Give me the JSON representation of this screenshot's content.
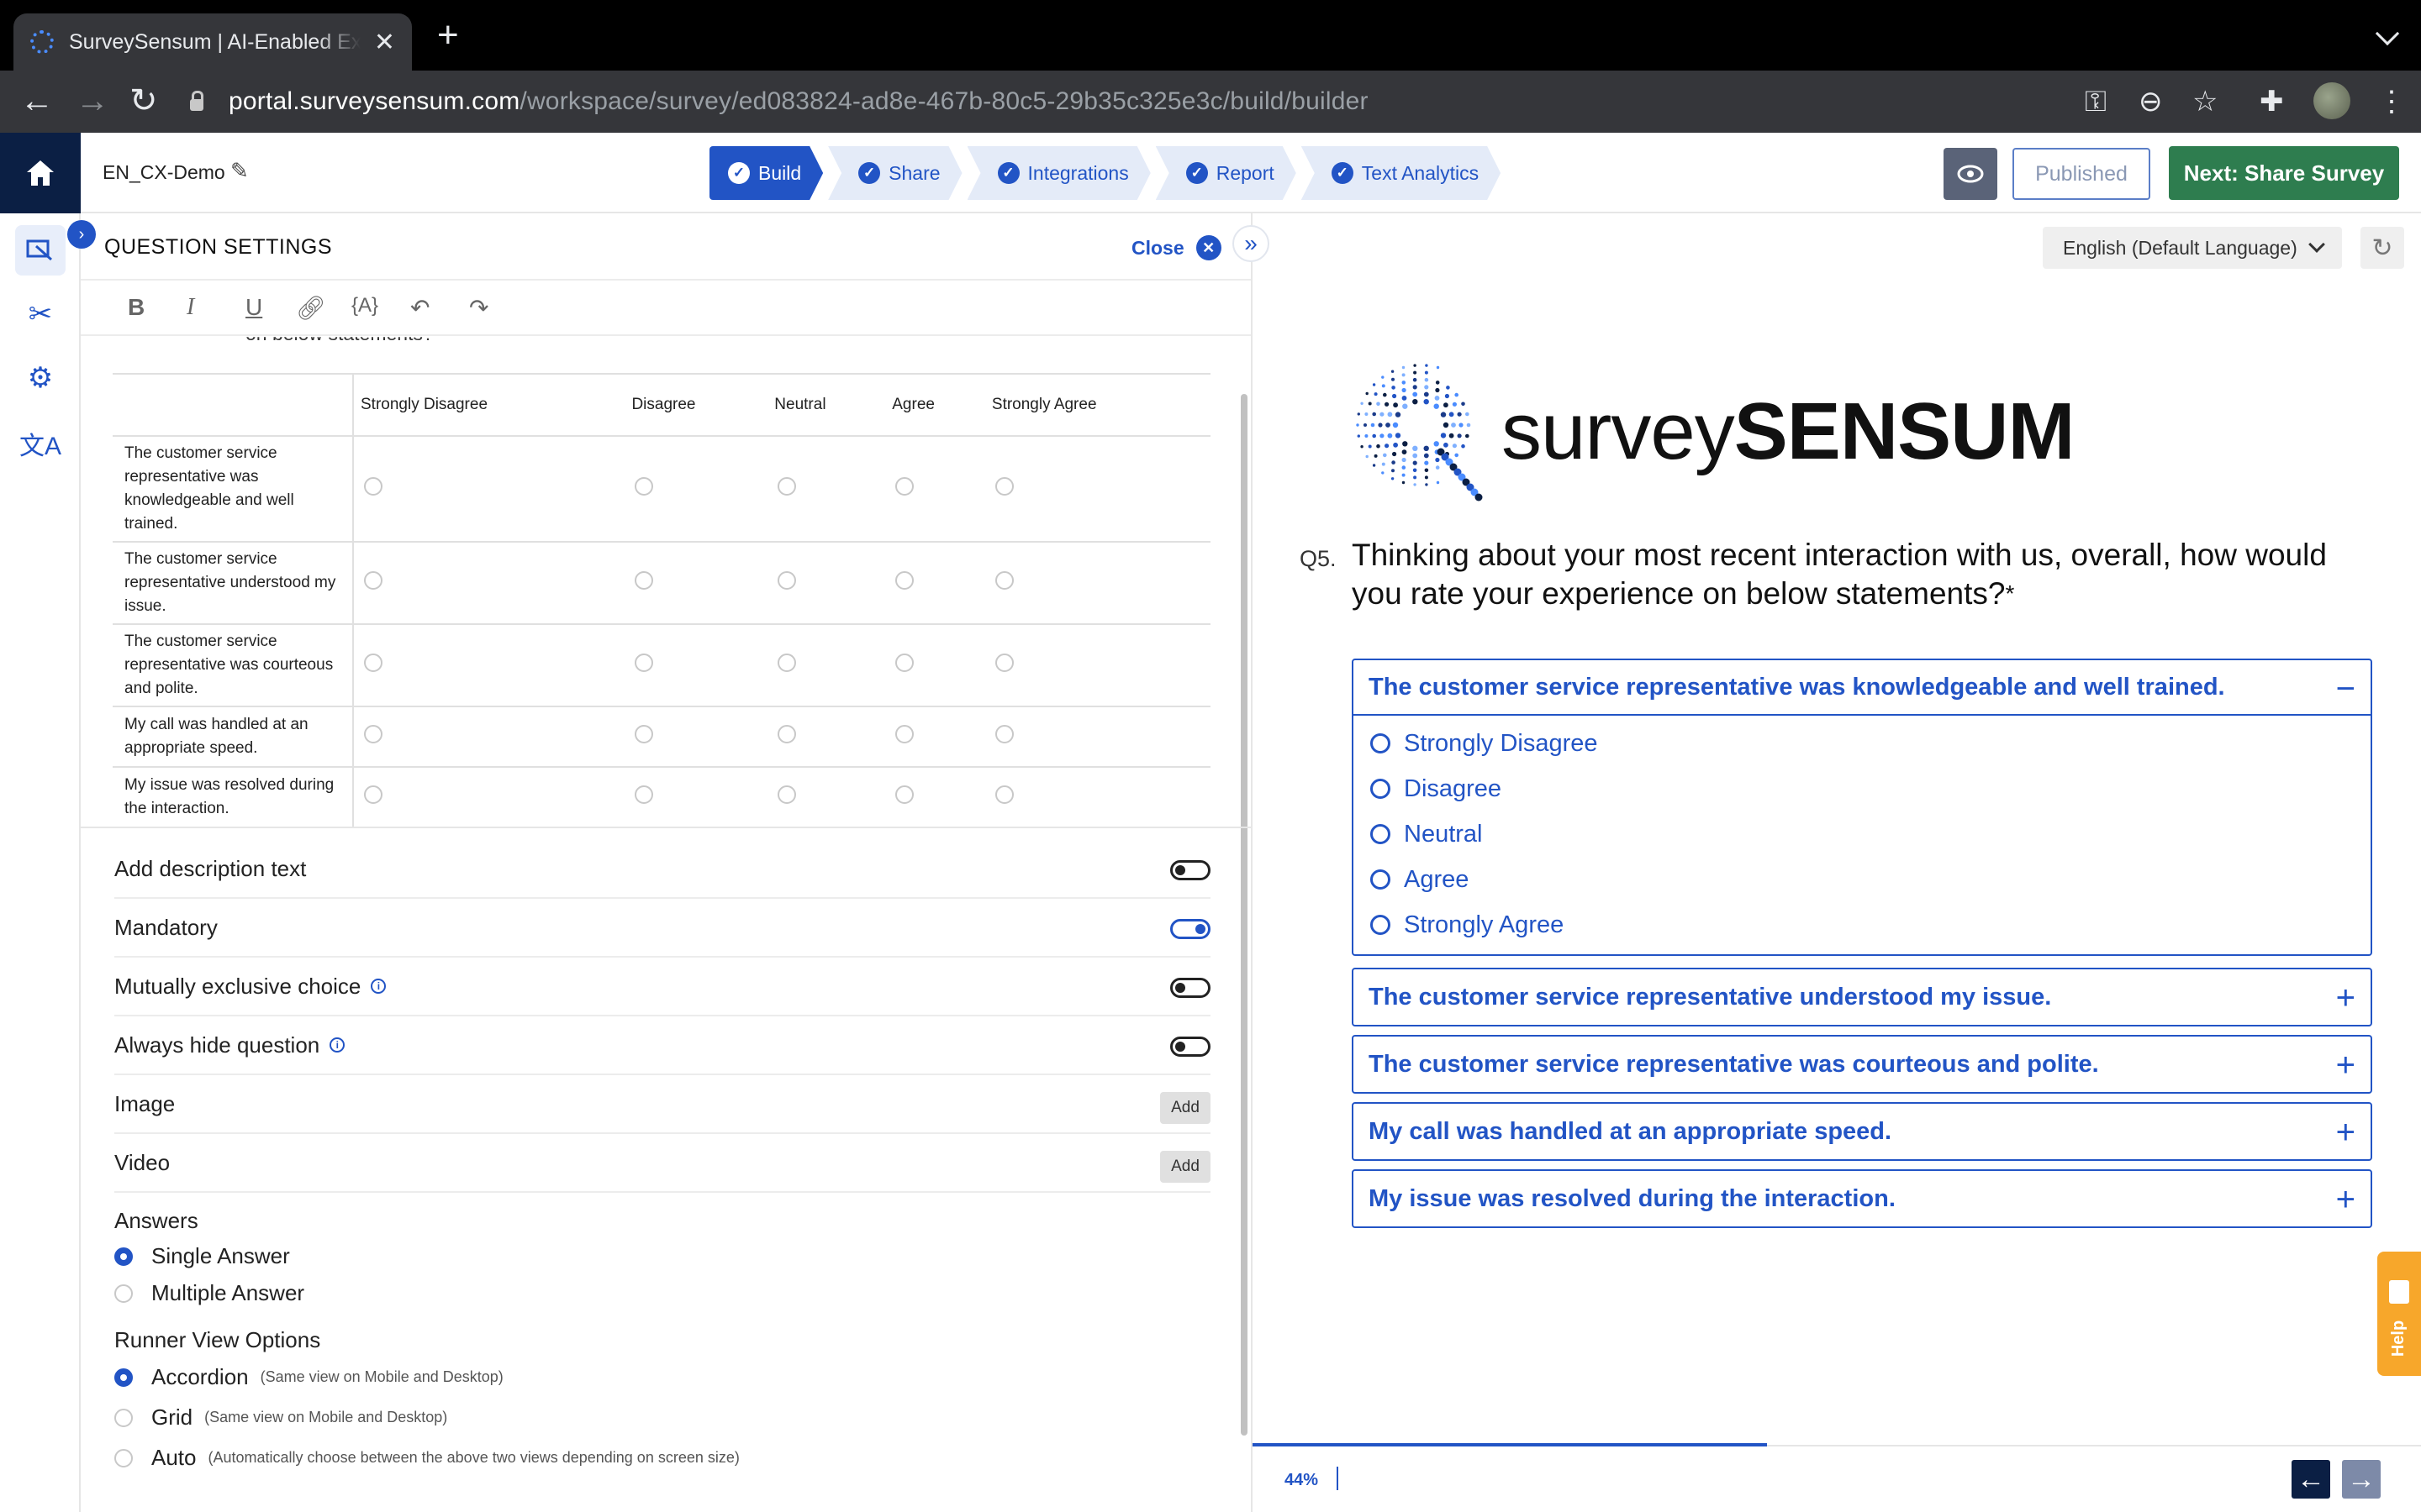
{
  "browser": {
    "tab_title": "SurveySensum | AI-Enabled Experience Management",
    "url_host": "portal.surveysensum.com",
    "url_path": "/workspace/survey/ed083824-ad8e-467b-80c5-29b35c325e3c/build/builder"
  },
  "header": {
    "survey_name": "EN_CX-Demo",
    "steps": [
      "Build",
      "Share",
      "Integrations",
      "Report",
      "Text Analytics"
    ],
    "active_step": "Build",
    "published_label": "Published",
    "next_label": "Next: Share Survey"
  },
  "settings": {
    "title": "QUESTION SETTINGS",
    "close_label": "Close",
    "clipped_text": "on below statements?",
    "matrix": {
      "columns": [
        "Strongly Disagree",
        "Disagree",
        "Neutral",
        "Agree",
        "Strongly Agree"
      ],
      "rows": [
        "The customer service representative was knowledgeable and well trained.",
        "The customer service representative understood my issue.",
        "The customer service representative was courteous and polite.",
        "My call was handled at an appropriate speed.",
        "My issue was resolved during the interaction."
      ]
    },
    "toggles": {
      "add_description": "Add description text",
      "mandatory": "Mandatory",
      "mutually_exclusive": "Mutually exclusive choice",
      "always_hide": "Always hide question"
    },
    "toggle_states": {
      "add_description": false,
      "mandatory": true,
      "mutually_exclusive": false,
      "always_hide": false
    },
    "image_label": "Image",
    "video_label": "Video",
    "add_label": "Add",
    "answers_label": "Answers",
    "answer_single": "Single Answer",
    "answer_multiple": "Multiple Answer",
    "runner_label": "Runner View Options",
    "runner_accordion": "Accordion",
    "runner_accordion_hint": "(Same view on Mobile and Desktop)",
    "runner_grid": "Grid",
    "runner_grid_hint": "(Same view on Mobile and Desktop)",
    "runner_auto": "Auto",
    "runner_auto_hint": "(Automatically choose between the above two views depending on screen size)"
  },
  "preview": {
    "language": "English (Default Language)",
    "logo_light": "survey",
    "logo_bold": "SENSUM",
    "question_number": "Q5.",
    "question_text": "Thinking about your most recent interaction with us, overall, how would you rate your experience on below statements?",
    "required_mark": "*",
    "options": [
      "Strongly Disagree",
      "Disagree",
      "Neutral",
      "Agree",
      "Strongly Agree"
    ],
    "statements": [
      "The customer service representative was knowledgeable and well trained.",
      "The customer service representative understood my issue.",
      "The customer service representative was courteous and polite.",
      "My call was handled at an appropriate speed.",
      "My issue was resolved during the interaction."
    ],
    "progress_percent": 44,
    "progress_label": "44%",
    "help_label": "Help"
  },
  "icons": {
    "home": "home-icon",
    "edit": "pencil-icon",
    "preview": "eye-icon",
    "rail": [
      "builder-icon",
      "design-tools-icon",
      "gear-icon",
      "translate-icon"
    ]
  },
  "colors": {
    "primary": "#2254c5",
    "navy": "#0b1f44",
    "success": "#2e7d4f",
    "help": "#f7a72b"
  }
}
